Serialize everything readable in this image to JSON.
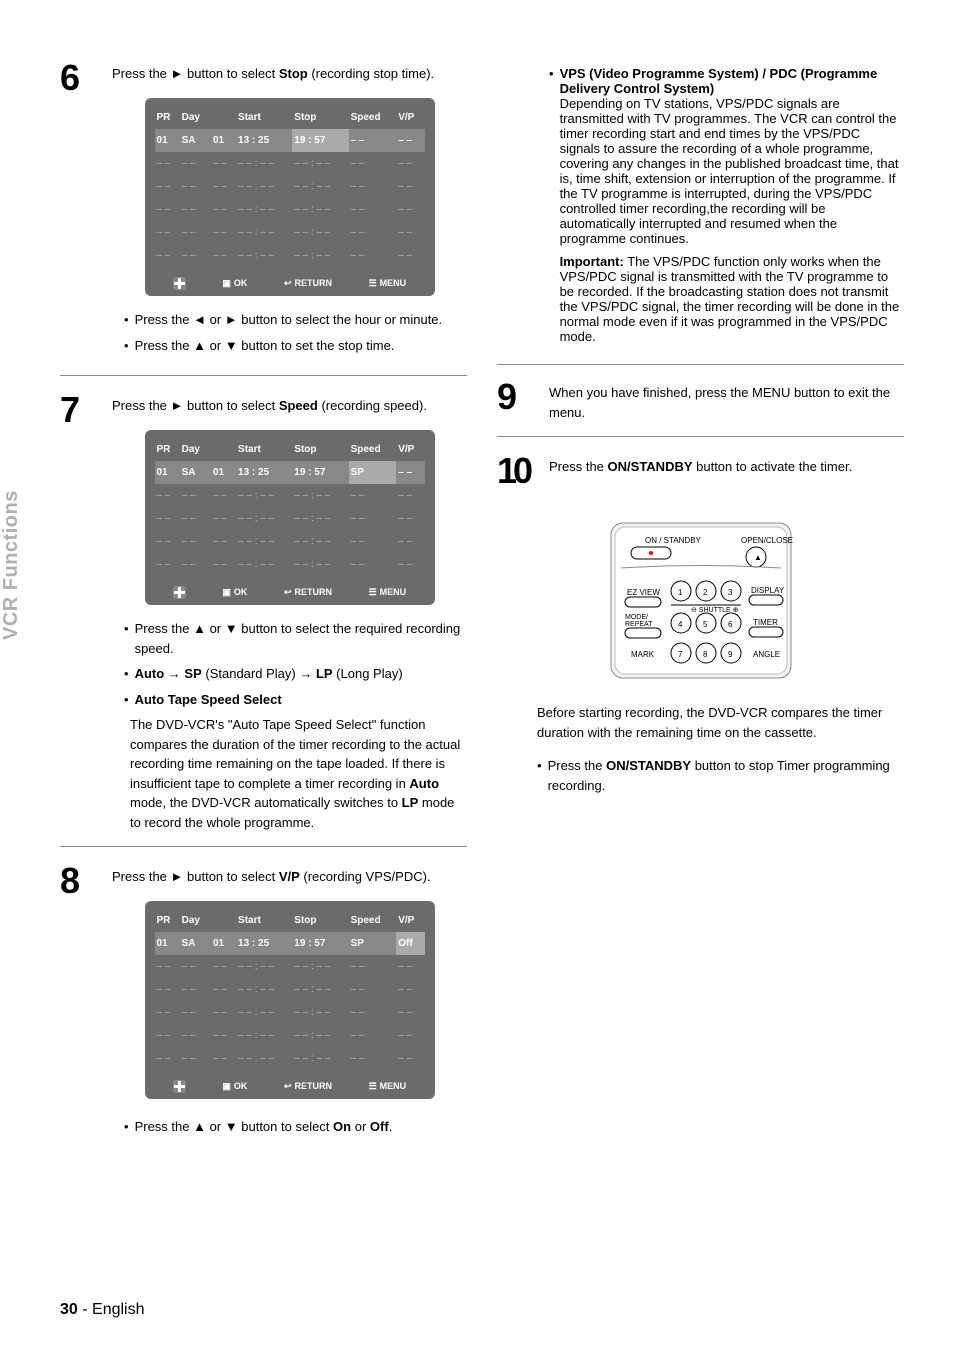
{
  "side_tab": "VCR Functions",
  "page_number": "30",
  "page_lang": "English",
  "icons": {
    "right": "►",
    "left": "◄",
    "up": "▲",
    "down": "▼",
    "arrow": "→"
  },
  "osd": {
    "headers": [
      "PR",
      "Day",
      "",
      "Start",
      "Stop",
      "Speed",
      "V/P"
    ],
    "footer": {
      "ok": "OK",
      "return": "RETURN",
      "menu": "MENU"
    },
    "empty_row": [
      "– –",
      "– –",
      "– –",
      "– – : – –",
      "– – : – –",
      "– –",
      "– –"
    ]
  },
  "step6": {
    "num": "6",
    "text_1": "Press the ",
    "text_2": " button to select ",
    "bold_stop": "Stop",
    "text_3": " (recording stop time).",
    "row1": [
      "01",
      "SA",
      "01",
      "13 : 25",
      "19 : 57",
      "– –",
      "– –"
    ],
    "b1_a": "Press the ",
    "b1_b": " or ",
    "b1_c": " button to select the hour or minute.",
    "b2_a": "Press the ",
    "b2_b": " or ",
    "b2_c": " button to set the stop time."
  },
  "step7": {
    "num": "7",
    "text_1": "Press the ",
    "text_2": " button to select ",
    "bold_speed": "Speed",
    "text_3": " (recording speed).",
    "row1": [
      "01",
      "SA",
      "01",
      "13 : 25",
      "19 : 57",
      "SP",
      "– –"
    ],
    "b1_a": "Press the ",
    "b1_b": " or ",
    "b1_c": " button to select the required recording speed.",
    "b2_auto": "Auto",
    "b2_sp": "SP",
    "b2_sp_txt": " (Standard Play) ",
    "b2_lp": "LP",
    "b2_lp_txt": " (Long Play)",
    "b3": "Auto Tape Speed Select",
    "b3_desc_a": "The DVD-VCR's \"Auto Tape Speed Select\" function compares the duration of the timer recording to the actual recording time remaining on the tape loaded. If there is insufficient tape to complete a timer recording in ",
    "b3_desc_b": " mode, the DVD-VCR automatically switches to ",
    "b3_desc_c": " mode to record the whole programme.",
    "b3_auto": "Auto",
    "b3_lp": "LP"
  },
  "step8": {
    "num": "8",
    "text_1": "Press the ",
    "text_2": " button to select ",
    "bold_vp": "V/P",
    "text_3": " (recording VPS/PDC).",
    "row1": [
      "01",
      "SA",
      "01",
      "13 : 25",
      "19 : 57",
      "SP",
      "Off"
    ],
    "b1_a": "Press the ",
    "b1_b": " or ",
    "b1_c": " button to select ",
    "b1_on": "On",
    "b1_or": " or ",
    "b1_off": "Off",
    "b1_end": "."
  },
  "right_top": {
    "heading": "VPS (Video Programme System) / PDC (Programme Delivery Control System)",
    "body": "Depending on TV stations, VPS/PDC signals are transmitted with TV programmes. The VCR can control the timer recording start and end times by the VPS/PDC signals to assure the recording of a whole programme, covering any changes in the published broadcast time, that is, time shift, extension or interruption of the programme. If the TV programme is interrupted, during the VPS/PDC controlled timer recording,the recording will be automatically interrupted and resumed when the programme continues.",
    "important_label": "Important:",
    "important_body": " The VPS/PDC function only works when the VPS/PDC signal is transmitted with the TV programme to be recorded. If the broadcasting station does not transmit the VPS/PDC signal, the timer recording will be done in the normal mode even if it was programmed in the VPS/PDC mode."
  },
  "step9": {
    "num": "9",
    "text": "When you have finished, press the MENU button to exit the menu."
  },
  "step10": {
    "num": "10",
    "text_a": "Press the ",
    "bold": "ON/STANDBY",
    "text_b": " button to activate the timer."
  },
  "remote_labels": {
    "standby": "ON / STANDBY",
    "open": "OPEN/CLOSE",
    "ezview": "EZ VIEW",
    "display": "DISPLAY",
    "mode": "MODE/ REPEAT",
    "timer": "TIMER",
    "mark": "MARK",
    "angle": "ANGLE",
    "shuttle": "SHUTTLE"
  },
  "after_remote": {
    "para": "Before starting recording, the DVD-VCR compares the timer duration with the remaining time on the cassette.",
    "b1_a": "Press the ",
    "b1_bold": "ON/STANDBY",
    "b1_b": " button to stop Timer programming recording."
  }
}
